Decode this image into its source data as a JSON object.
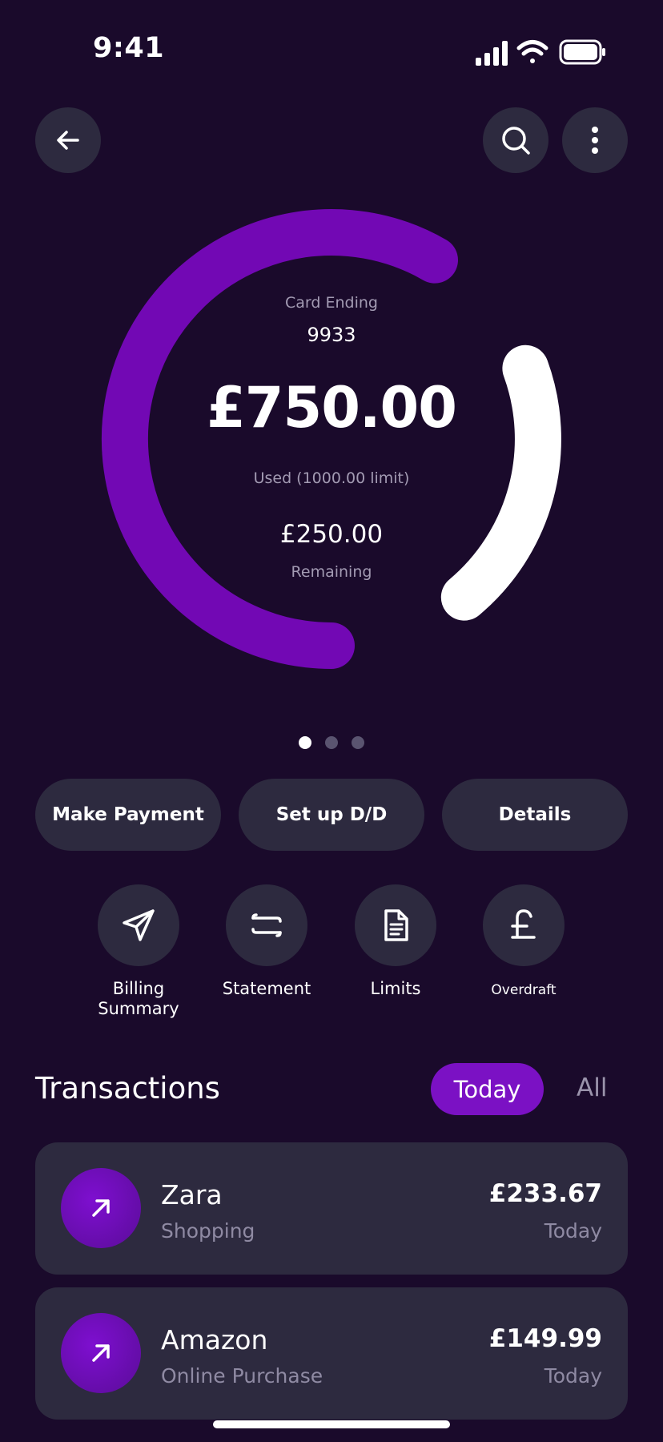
{
  "status_bar": {
    "time": "9:41",
    "icons": [
      "signal-icon",
      "wifi-icon",
      "battery-icon"
    ]
  },
  "header": {
    "back_icon": "arrow-left-icon",
    "search_icon": "search-icon",
    "more_icon": "more-vertical-icon"
  },
  "summary": {
    "card_ending_label": "Card Ending",
    "card_ending_number": "9933",
    "used_amount": "£750.00",
    "used_caption": "Used (1000.00 limit)",
    "remaining_amount": "£250.00",
    "remaining_caption": "Remaining",
    "used_fraction": 0.75,
    "ring_colors": {
      "used": "#7208b4",
      "remaining": "#ffffff"
    }
  },
  "pager": {
    "count": 3,
    "active_index": 0
  },
  "actions": {
    "make_payment": "Make Payment",
    "setup_dd": "Set up D/D",
    "details": "Details"
  },
  "quick_actions": [
    {
      "label": "Billing Summary",
      "icon": "send-icon"
    },
    {
      "label": "Statement",
      "icon": "transfer-icon"
    },
    {
      "label": "Limits",
      "icon": "document-icon"
    },
    {
      "label": "Overdraft",
      "icon": "pound-icon"
    }
  ],
  "transactions": {
    "title": "Transactions",
    "tabs": {
      "today": "Today",
      "all": "All",
      "active": "today"
    },
    "items": [
      {
        "merchant": "Zara",
        "category": "Shopping",
        "amount": "£233.67",
        "date": "Today",
        "icon": "arrow-up-right-icon"
      },
      {
        "merchant": "Amazon",
        "category": "Online Purchase",
        "amount": "£149.99",
        "date": "Today",
        "icon": "arrow-up-right-icon"
      }
    ]
  },
  "colors": {
    "background": "#1a0a2b",
    "surface": "#2d2a3f",
    "accent": "#7b11c4",
    "muted_text": "#8f8aa3"
  }
}
